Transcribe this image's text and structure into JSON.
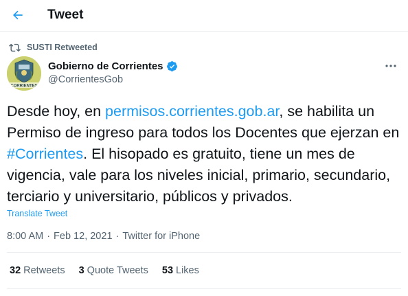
{
  "header": {
    "title": "Tweet"
  },
  "retweet": {
    "label": "SUSTI Retweeted"
  },
  "author": {
    "name": "Gobierno de Corrientes",
    "handle": "@CorrientesGob",
    "avatar_text": "CORRIENTES",
    "verified": true
  },
  "tweet": {
    "segments": [
      {
        "text": "Desde hoy, en ",
        "type": "text"
      },
      {
        "text": "permisos.corrientes.gob.ar",
        "type": "link"
      },
      {
        "text": ", se habilita un Permiso de ingreso para todos los Docentes que ejerzan en ",
        "type": "text"
      },
      {
        "text": "#Corrientes",
        "type": "link"
      },
      {
        "text": ". El hisopado es gratuito, tiene un mes de vigencia, vale para los niveles inicial, primario, secundario, terciario y universitario, públicos y privados.",
        "type": "text"
      }
    ],
    "translate_label": "Translate Tweet"
  },
  "meta": {
    "time": "8:00 AM",
    "separator1": "·",
    "date": "Feb 12, 2021",
    "separator2": "·",
    "source": "Twitter for iPhone"
  },
  "stats": {
    "retweets_count": "32",
    "retweets_label": "Retweets",
    "quotes_count": "3",
    "quotes_label": "Quote Tweets",
    "likes_count": "53",
    "likes_label": "Likes"
  },
  "colors": {
    "accent": "#1d9bf0",
    "text_primary": "#0f1419",
    "text_secondary": "#536471",
    "divider": "#ebeef0"
  }
}
